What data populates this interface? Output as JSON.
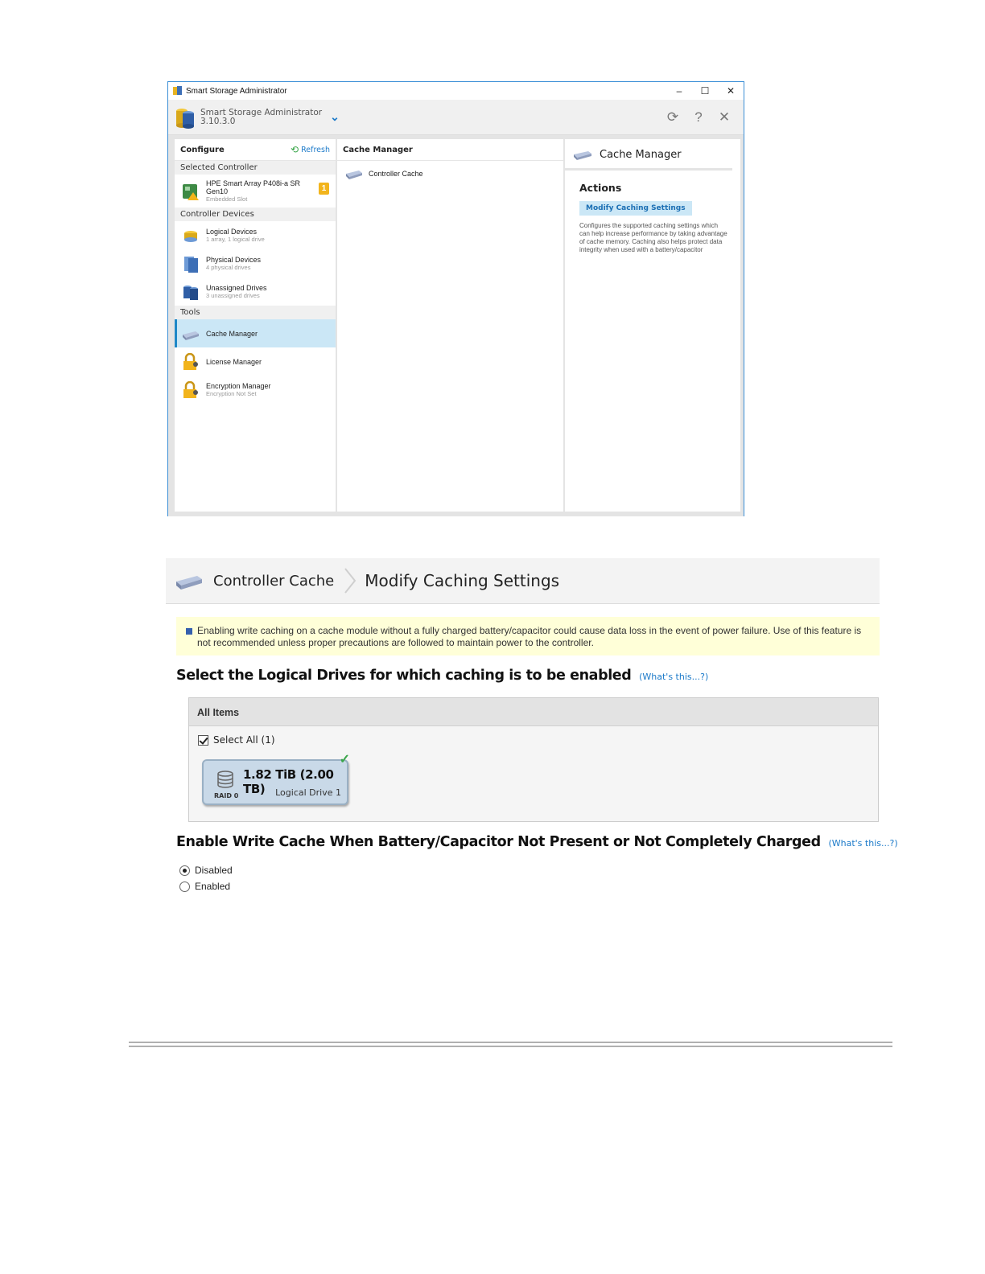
{
  "window": {
    "title": "Smart Storage Administrator",
    "app_name": "Smart Storage Administrator",
    "version": "3.10.3.0",
    "controls": {
      "minimize": "–",
      "maximize": "☐",
      "close": "✕"
    },
    "toolbar": {
      "refresh_icon": "⟳",
      "help": "?",
      "close": "✕"
    }
  },
  "left_pane": {
    "title": "Configure",
    "refresh": "Refresh",
    "sections": {
      "selected_controller": "Selected Controller",
      "controller_devices": "Controller Devices",
      "tools": "Tools"
    },
    "controller": {
      "name": "HPE Smart Array P408i-a SR Gen10",
      "sub": "Embedded Slot",
      "badge": "1"
    },
    "devices": [
      {
        "label": "Logical Devices",
        "sub": "1 array, 1 logical drive"
      },
      {
        "label": "Physical Devices",
        "sub": "4 physical drives"
      },
      {
        "label": "Unassigned Drives",
        "sub": "3 unassigned drives"
      }
    ],
    "tools": [
      {
        "label": "Cache Manager",
        "sub": ""
      },
      {
        "label": "License Manager",
        "sub": ""
      },
      {
        "label": "Encryption Manager",
        "sub": "Encryption Not Set"
      }
    ]
  },
  "middle_pane": {
    "title": "Cache Manager",
    "items": [
      {
        "label": "Controller Cache"
      }
    ]
  },
  "right_pane": {
    "title": "Cache Manager",
    "actions_heading": "Actions",
    "action_button": "Modify Caching Settings",
    "action_description": "Configures the supported caching settings which can help increase performance by taking advantage of cache memory. Caching also helps protect data integrity when used with a battery/capacitor"
  },
  "modify": {
    "breadcrumb": {
      "parent": "Controller Cache",
      "current": "Modify Caching Settings"
    },
    "warning": "Enabling write caching on a cache module without a fully charged battery/capacitor could cause data loss in the event of power failure. Use of this feature is not recommended unless proper precautions are followed to maintain power to the controller.",
    "select_heading": "Select the Logical Drives for which caching is to be enabled",
    "whats_this": "(What's this...?)",
    "list_header": "All Items",
    "select_all": "Select All (1)",
    "drive": {
      "capacity": "1.82 TiB (2.00 TB)",
      "name": "Logical Drive 1",
      "raid": "RAID 0"
    },
    "write_cache_heading": "Enable Write Cache When Battery/Capacitor Not Present or Not Completely Charged",
    "options": {
      "disabled": "Disabled",
      "enabled": "Enabled",
      "selected": "Disabled"
    }
  }
}
